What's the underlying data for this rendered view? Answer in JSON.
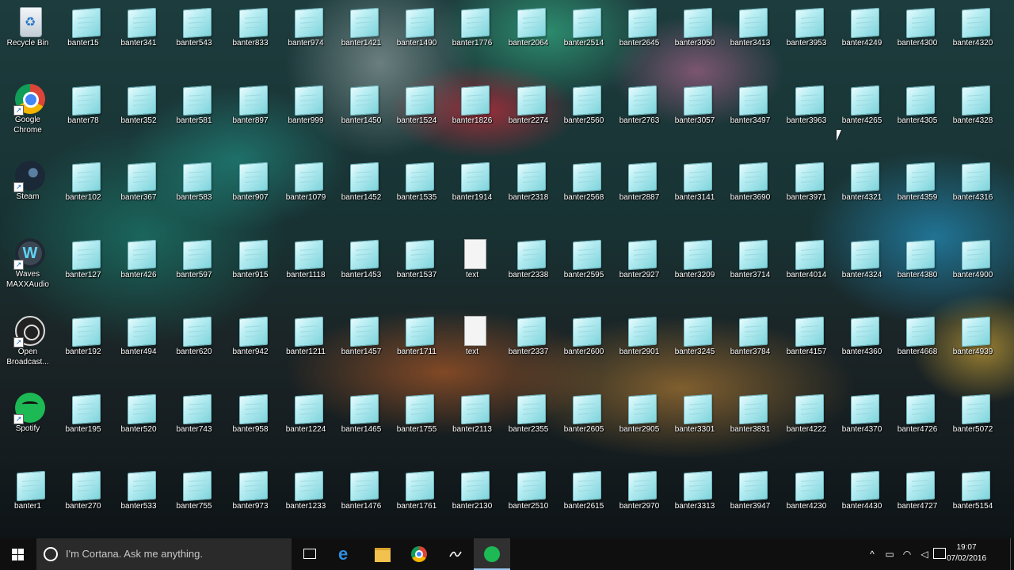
{
  "desktop": {
    "system_icons": [
      {
        "label": "Recycle Bin",
        "icon": "recycle-bin-icon"
      },
      {
        "label": "Google Chrome",
        "icon": "chrome-icon"
      },
      {
        "label": "Steam",
        "icon": "steam-icon"
      },
      {
        "label": "Waves MAXXAudio",
        "icon": "waves-icon"
      },
      {
        "label": "Open Broadcast...",
        "icon": "obs-icon"
      },
      {
        "label": "Spotify",
        "icon": "spotify-icon"
      },
      {
        "label": "banter1",
        "icon": "notepad-file-icon"
      }
    ],
    "file_columns": [
      [
        "banter15",
        "banter78",
        "banter102",
        "banter127",
        "banter192",
        "banter195",
        "banter270"
      ],
      [
        "banter341",
        "banter352",
        "banter367",
        "banter426",
        "banter494",
        "banter520",
        "banter533"
      ],
      [
        "banter543",
        "banter581",
        "banter583",
        "banter597",
        "banter620",
        "banter743",
        "banter755"
      ],
      [
        "banter833",
        "banter897",
        "banter907",
        "banter915",
        "banter942",
        "banter958",
        "banter973"
      ],
      [
        "banter974",
        "banter999",
        "banter1079",
        "banter1118",
        "banter1211",
        "banter1224",
        "banter1233"
      ],
      [
        "banter1421",
        "banter1450",
        "banter1452",
        "banter1453",
        "banter1457",
        "banter1465",
        "banter1476"
      ],
      [
        "banter1490",
        "banter1524",
        "banter1535",
        "banter1537",
        "banter1711",
        "banter1755",
        "banter1761"
      ],
      [
        "banter1776",
        "banter1826",
        "banter1914",
        "text",
        "text",
        "banter2113",
        "banter2130"
      ],
      [
        "banter2064",
        "banter2274",
        "banter2318",
        "banter2338",
        "banter2337",
        "banter2355",
        "banter2510"
      ],
      [
        "banter2514",
        "banter2560",
        "banter2568",
        "banter2595",
        "banter2600",
        "banter2605",
        "banter2615"
      ],
      [
        "banter2645",
        "banter2763",
        "banter2887",
        "banter2927",
        "banter2901",
        "banter2905",
        "banter2970"
      ],
      [
        "banter3050",
        "banter3057",
        "banter3141",
        "banter3209",
        "banter3245",
        "banter3301",
        "banter3313"
      ],
      [
        "banter3413",
        "banter3497",
        "banter3690",
        "banter3714",
        "banter3784",
        "banter3831",
        "banter3947"
      ],
      [
        "banter3953",
        "banter3963",
        "banter3971",
        "banter4014",
        "banter4157",
        "banter4222",
        "banter4230"
      ],
      [
        "banter4249",
        "banter4265",
        "banter4321",
        "banter4324",
        "banter4360",
        "banter4370",
        "banter4430"
      ],
      [
        "banter4300",
        "banter4305",
        "banter4359",
        "banter4380",
        "banter4668",
        "banter4726",
        "banter4727"
      ],
      [
        "banter4320",
        "banter4328",
        "banter4316",
        "banter4900",
        "banter4939",
        "banter5072",
        "banter5154"
      ]
    ]
  },
  "taskbar": {
    "cortana_placeholder": "I'm Cortana. Ask me anything.",
    "pinned": [
      {
        "name": "task-view-button",
        "icon": "task-view-icon"
      },
      {
        "name": "edge-button",
        "icon": "edge-icon"
      },
      {
        "name": "file-explorer-button",
        "icon": "folder-icon"
      },
      {
        "name": "chrome-button",
        "icon": "chrome-icon"
      },
      {
        "name": "obs-button",
        "icon": "obs-icon"
      },
      {
        "name": "spotify-button",
        "icon": "spotify-icon",
        "active": true
      }
    ],
    "tray_icons": [
      "chevron-up-icon",
      "battery-icon",
      "network-icon",
      "volume-icon",
      "keyboard-icon"
    ],
    "time": "19:07",
    "date": "07/02/2016",
    "edge_glyph": "e",
    "waves_glyph": "W"
  }
}
